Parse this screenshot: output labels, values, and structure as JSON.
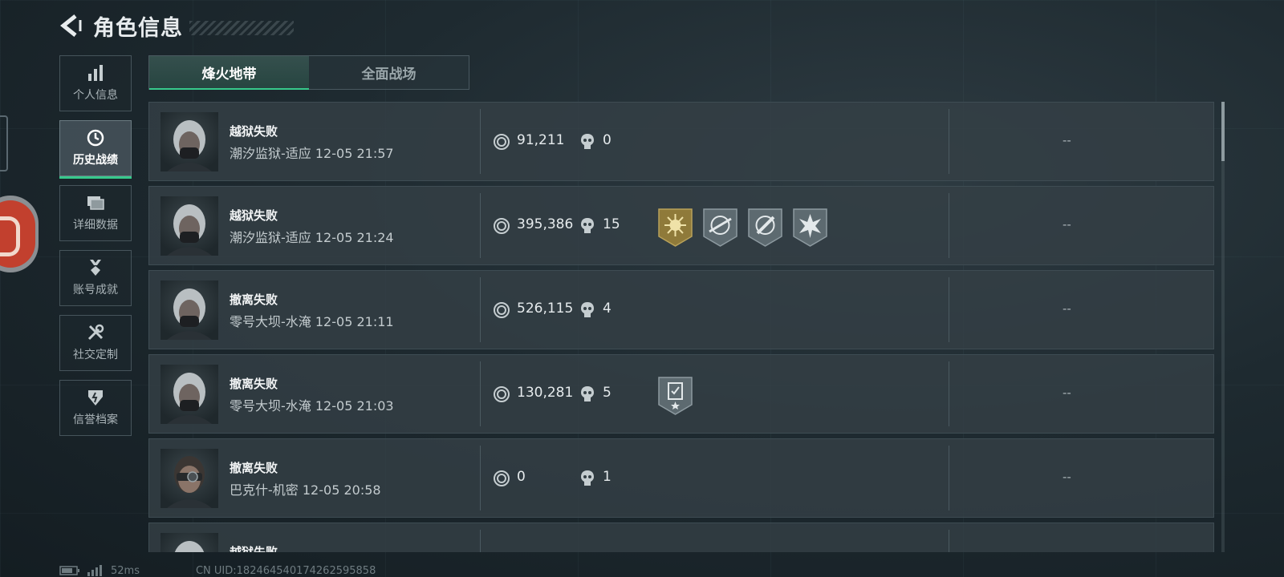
{
  "header": {
    "title": "角色信息"
  },
  "sidebar": {
    "items": [
      {
        "label": "个人信息",
        "icon": "bar-chart-icon",
        "active": false
      },
      {
        "label": "历史战绩",
        "icon": "history-clock-icon",
        "active": true
      },
      {
        "label": "详细数据",
        "icon": "cards-icon",
        "active": false
      },
      {
        "label": "账号成就",
        "icon": "medal-icon",
        "active": false
      },
      {
        "label": "社交定制",
        "icon": "tools-icon",
        "active": false
      },
      {
        "label": "信誉档案",
        "icon": "shield-icon",
        "active": false
      }
    ]
  },
  "tabs": [
    {
      "label": "烽火地带",
      "active": true
    },
    {
      "label": "全面战场",
      "active": false
    }
  ],
  "records": [
    {
      "result": "越狱失败",
      "map": "潮汐监狱-适应",
      "time": "12-05 21:57",
      "value": "91,211",
      "kills": "0",
      "badges": [],
      "extra": "--",
      "avatar": "masked-operator"
    },
    {
      "result": "越狱失败",
      "map": "潮汐监狱-适应",
      "time": "12-05 21:24",
      "value": "395,386",
      "kills": "15",
      "badges": [
        "gold-sun-badge-icon",
        "crosshair-rifle-badge-icon",
        "crosshair-knife-badge-icon",
        "explosion-badge-icon"
      ],
      "extra": "--",
      "avatar": "masked-operator"
    },
    {
      "result": "撤离失败",
      "map": "零号大坝-水淹",
      "time": "12-05 21:11",
      "value": "526,115",
      "kills": "4",
      "badges": [],
      "extra": "--",
      "avatar": "masked-operator"
    },
    {
      "result": "撤离失败",
      "map": "零号大坝-水淹",
      "time": "12-05 21:03",
      "value": "130,281",
      "kills": "5",
      "badges": [
        "clipboard-star-badge-icon"
      ],
      "extra": "--",
      "avatar": "masked-operator"
    },
    {
      "result": "撤离失败",
      "map": "巴克什-机密",
      "time": "12-05 20:58",
      "value": "0",
      "kills": "1",
      "badges": [],
      "extra": "--",
      "avatar": "goggle-operator"
    },
    {
      "result": "越狱失败",
      "map": "",
      "time": "",
      "value": "",
      "kills": "",
      "badges": [],
      "extra": "",
      "avatar": "masked-operator"
    }
  ],
  "status": {
    "ping": "52ms",
    "uid": "CN UID:182464540174262595858"
  },
  "colors": {
    "accent": "#37c98c",
    "background": "#1e2a30",
    "row": "#343f45",
    "badge_gold": "#8f7a3a",
    "badge_steel": "#5d6a70"
  }
}
